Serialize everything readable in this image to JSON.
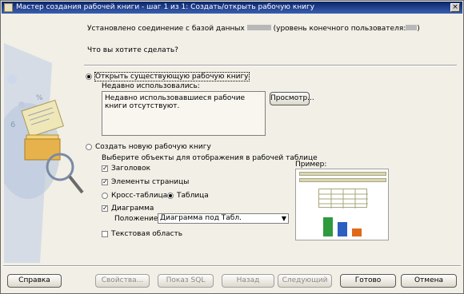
{
  "window": {
    "title": "Мастер создания рабочей книги - шаг 1 из 1: Создать/открыть рабочую книгу",
    "close_glyph": "×"
  },
  "header": {
    "info_prefix": "Установлено соединение с базой данных",
    "info_suffix": "(уровень конечного пользователя:",
    "info_end": ")",
    "question": "Что вы хотите сделать?"
  },
  "open_existing": {
    "label": "Открыть существующую рабочую книгу",
    "selected": true,
    "recent_label": "Недавно использовались:",
    "recent_text": "Недавно использовавшиеся рабочие книги отсутствуют.",
    "browse_label": "Просмотр..."
  },
  "create_new": {
    "label": "Создать новую рабочую книгу",
    "selected": false,
    "objects_label": "Выберите объекты для отображения в рабочей таблице",
    "title_label": "Заголовок",
    "title_checked": true,
    "page_items_label": "Элементы страницы",
    "page_items_checked": true,
    "crosstab_label": "Кросс-таблица",
    "table_label": "Таблица",
    "table_selected": true,
    "chart_label": "Диаграмма",
    "chart_checked": true,
    "position_label": "Положение:",
    "position_value": "Диаграмма под Табл.",
    "text_area_label": "Текстовая область",
    "text_area_checked": false,
    "preview_label": "Пример:"
  },
  "preview_colors": {
    "bar1": "#2e9a3e",
    "bar2": "#2b5fc0",
    "bar3": "#e06a1a"
  },
  "footer": {
    "help": "Справка",
    "properties": "Свойства...",
    "show_sql": "Показ SQL",
    "back": "Назад",
    "next": "Следующий",
    "finish": "Готово",
    "cancel": "Отмена"
  }
}
